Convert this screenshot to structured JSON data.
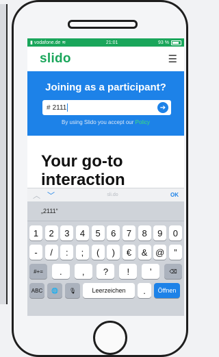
{
  "status": {
    "carrier": "vodafone.de",
    "time": "21:01",
    "battery": "93 %"
  },
  "nav": {
    "logo": "slido",
    "menu_icon": "hamburger-icon"
  },
  "join": {
    "title": "Joining as a participant?",
    "hash": "#",
    "code_value": "2111",
    "submit_icon": "arrow-right-icon",
    "terms_prefix": "By using Slido you accept our",
    "terms_link": "Policy"
  },
  "hero": {
    "line1": "Your go-to",
    "line2": "interaction"
  },
  "keyboard_toolbar": {
    "up_icon": "chevron-up-icon",
    "down_icon": "chevron-down-icon",
    "domain": "sli.do",
    "ok_label": "OK"
  },
  "keyboard": {
    "suggestion": "„2111“",
    "row1": [
      "1",
      "2",
      "3",
      "4",
      "5",
      "6",
      "7",
      "8",
      "9",
      "0"
    ],
    "row2": [
      "-",
      "/",
      ":",
      ";",
      "(",
      ")",
      "€",
      "&",
      "@",
      "”"
    ],
    "row3_shift": "#+=",
    "row3": [
      ".",
      ",",
      "?",
      "!",
      "’"
    ],
    "row3_delete": "⌫",
    "row4_abc": "ABC",
    "row4_globe": "🌐",
    "row4_mic": "🎙",
    "row4_space": "Leerzeichen",
    "row4_period": ".",
    "row4_enter": "Öffnen"
  },
  "colors": {
    "brand_green": "#1aa65b",
    "panel_blue": "#1d82e8",
    "policy_green": "#3ce07a"
  }
}
